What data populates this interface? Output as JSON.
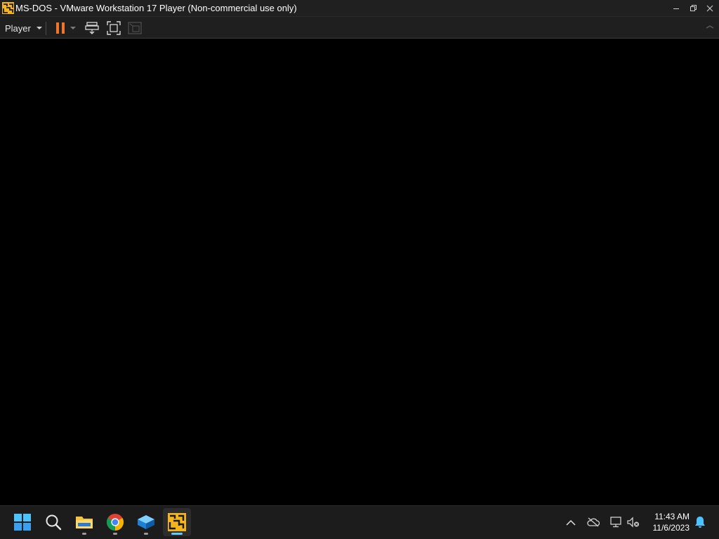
{
  "window": {
    "title": "MS-DOS - VMware Workstation 17 Player (Non-commercial use only)"
  },
  "toolbar": {
    "player_menu_label": "Player"
  },
  "taskbar": {
    "time": "11:43 AM",
    "date": "11/6/2023"
  },
  "colors": {
    "pause_accent": "#f0742a",
    "vmware_brand": "#f4b41a",
    "active_indicator": "#60cdff"
  },
  "icons": [
    "vmware-icon",
    "minimize-icon",
    "maximize-icon",
    "close-icon",
    "pause-icon",
    "dropdown-caret-icon",
    "send-ctrl-alt-del-icon",
    "full-screen-icon",
    "unity-icon",
    "windows-start-icon",
    "search-icon",
    "file-explorer-icon",
    "chrome-icon",
    "sandbox-icon",
    "vmware-player-icon",
    "chevron-up-icon",
    "cloud-off-icon",
    "network-icon",
    "speaker-muted-icon",
    "bell-icon"
  ]
}
